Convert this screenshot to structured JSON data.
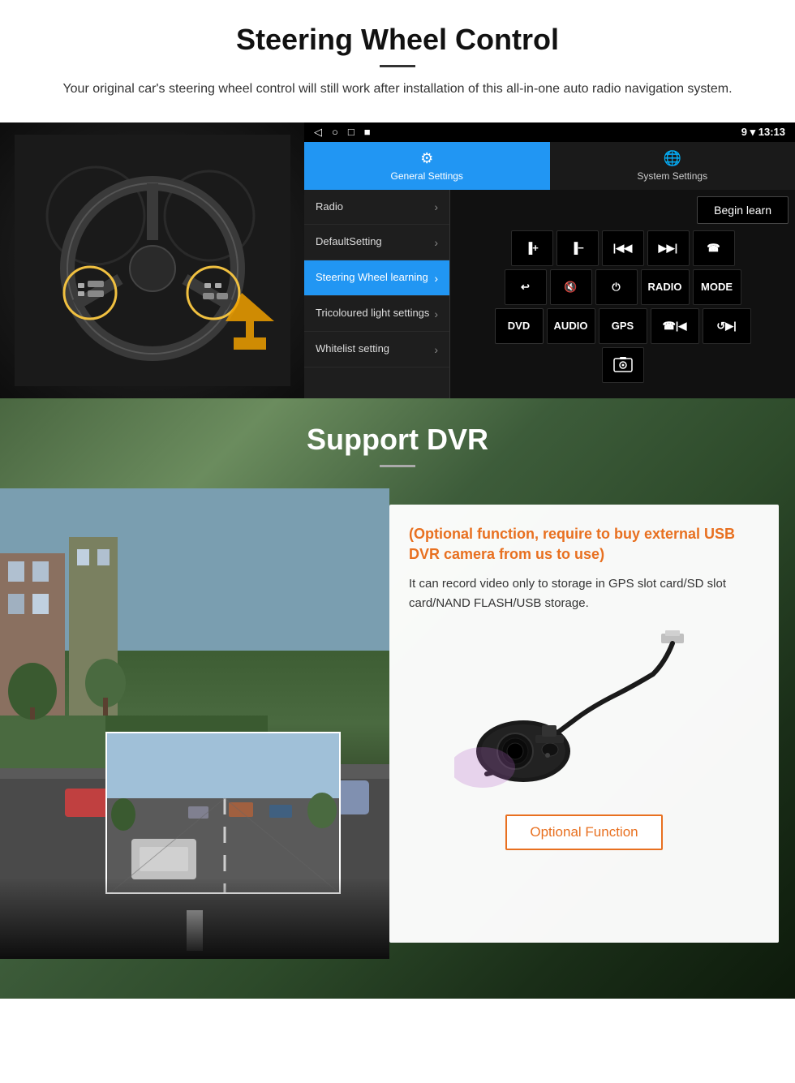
{
  "page": {
    "section1": {
      "title": "Steering Wheel Control",
      "subtitle": "Your original car's steering wheel control will still work after installation of this all-in-one auto radio navigation system.",
      "android": {
        "statusbar": {
          "nav_icons": [
            "◁",
            "○",
            "□",
            "■"
          ],
          "right": "9 ▾ 13:13"
        },
        "tabs": [
          {
            "icon": "⚙",
            "label": "General Settings",
            "active": true
          },
          {
            "icon": "⚙",
            "label": "System Settings",
            "active": false
          }
        ],
        "menu_items": [
          {
            "label": "Radio",
            "active": false
          },
          {
            "label": "DefaultSetting",
            "active": false
          },
          {
            "label": "Steering Wheel learning",
            "active": true
          },
          {
            "label": "Tricoloured light settings",
            "active": false
          },
          {
            "label": "Whitelist setting",
            "active": false
          }
        ],
        "begin_learn": "Begin learn",
        "control_buttons": [
          [
            "vol+",
            "vol-",
            "|◀◀",
            "▶▶|",
            "☎"
          ],
          [
            "↩",
            "🔇",
            "⏻",
            "RADIO",
            "MODE"
          ],
          [
            "DVD",
            "AUDIO",
            "GPS",
            "☎|◀◀",
            "↺▶▶|"
          ],
          [
            "⬛"
          ]
        ]
      }
    },
    "section2": {
      "title": "Support DVR",
      "optional_title": "(Optional function, require to buy external USB DVR camera from us to use)",
      "description": "It can record video only to storage in GPS slot card/SD slot card/NAND FLASH/USB storage.",
      "optional_function_btn": "Optional Function"
    }
  }
}
